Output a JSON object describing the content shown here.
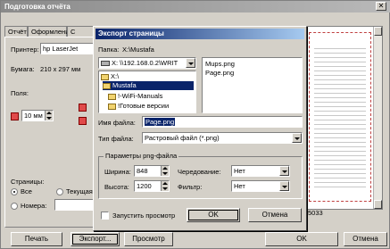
{
  "main_window": {
    "title": "Подготовка отчёта",
    "close_glyph": "✕",
    "tabs": [
      {
        "label": "Отчёт"
      },
      {
        "label": "Оформление"
      },
      {
        "label": "С"
      }
    ],
    "printer_label": "Принтер:",
    "printer_value": "hp LaserJet",
    "paper_label": "Бумага:",
    "paper_value": "210 x 297 мм",
    "margins_label": "Поля:",
    "margin_left_value": "10 мм",
    "pages_label": "Страницы:",
    "pages_all": "Все",
    "pages_current": "Текущая",
    "pages_numbers": "Номера:",
    "partial_value": "5033",
    "bottom_buttons": {
      "print": "Печать",
      "export": "Экспорт...",
      "preview": "Просмотр",
      "ok": "OK",
      "cancel": "Отмена"
    }
  },
  "export_dialog": {
    "title": "Экспорт страницы",
    "folder_label": "Папка:",
    "folder_path": "X:\\Mustafa",
    "drive_value": "X: \\\\192.168.0.2\\WRIT",
    "tree": [
      {
        "label": "X:\\"
      },
      {
        "label": "Mustafa"
      },
      {
        "label": "!-WiFi-Manuals"
      },
      {
        "label": "!Готовые версии"
      }
    ],
    "files": [
      "Mups.png",
      "Page.png"
    ],
    "filename_label": "Имя файла:",
    "filename_value": "Page.png",
    "filetype_label": "Тип файла:",
    "filetype_value": "Растровый файл (*.png)",
    "png_group_label": "Параметры png-файла",
    "width_label": "Ширина:",
    "width_value": "848",
    "height_label": "Высота:",
    "height_value": "1200",
    "interlace_label": "Чередование:",
    "interlace_value": "Нет",
    "filter_label": "Фильтр:",
    "filter_value": "Нет",
    "launch_preview_label": "Запустить просмотр",
    "ok": "OK",
    "cancel": "Отмена"
  }
}
